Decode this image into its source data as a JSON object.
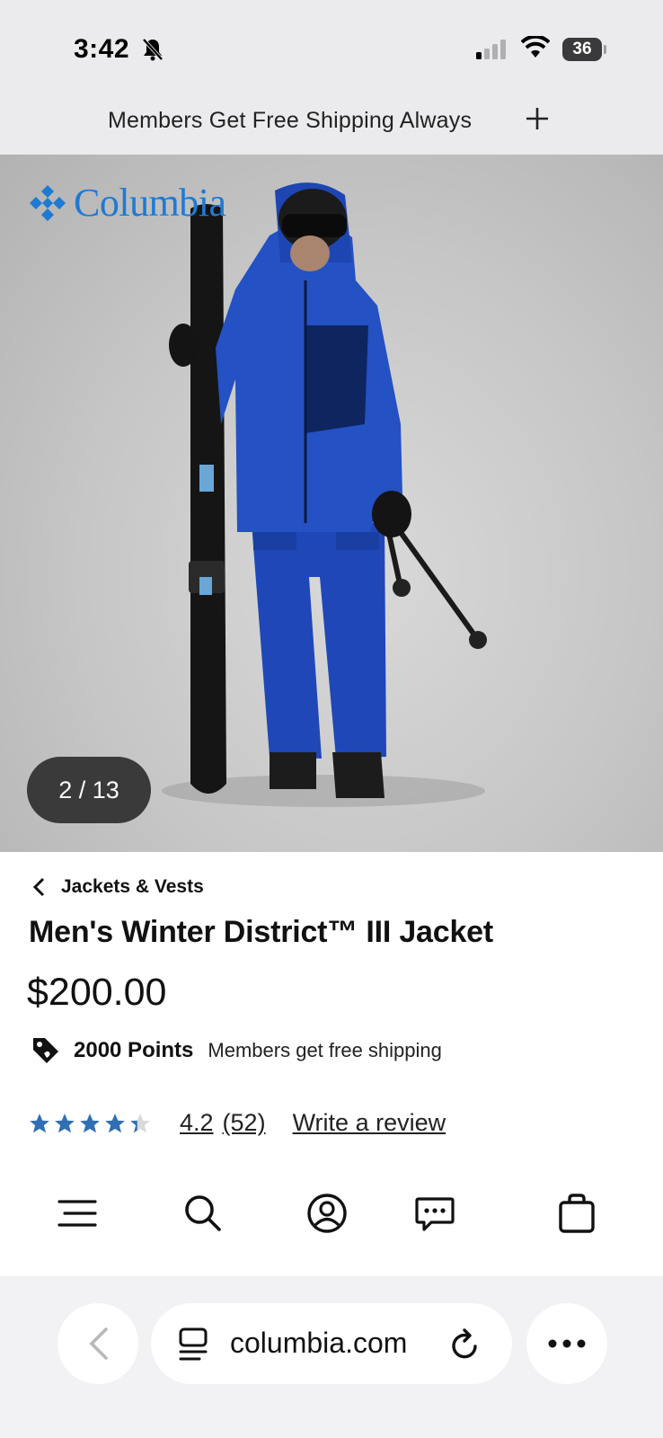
{
  "status_bar": {
    "time": "3:42",
    "battery": "36",
    "icons": [
      "bell-slash-icon",
      "signal-icon",
      "wifi-icon",
      "battery-icon"
    ]
  },
  "promo": {
    "text": "Members Get Free Shipping Always",
    "icon": "plus-icon"
  },
  "hero": {
    "logo_text": "Columbia",
    "slide_counter": "2 / 13",
    "brand_color": "#1f7ad1"
  },
  "product": {
    "breadcrumb": "Jackets & Vests",
    "title": "Men's Winter District™ III Jacket",
    "price": "$200.00",
    "points": "2000 Points",
    "shipping_note": "Members get free shipping",
    "rating": "4.2",
    "review_count": "(52)",
    "write_review": "Write a review",
    "stars_filled": 4.2,
    "stars_total": 5,
    "star_color": "#2f6fb3"
  },
  "bottom_nav": {
    "items": [
      "menu-icon",
      "search-icon",
      "account-icon",
      "chat-icon",
      "bag-icon"
    ]
  },
  "browser": {
    "url": "columbia.com"
  }
}
